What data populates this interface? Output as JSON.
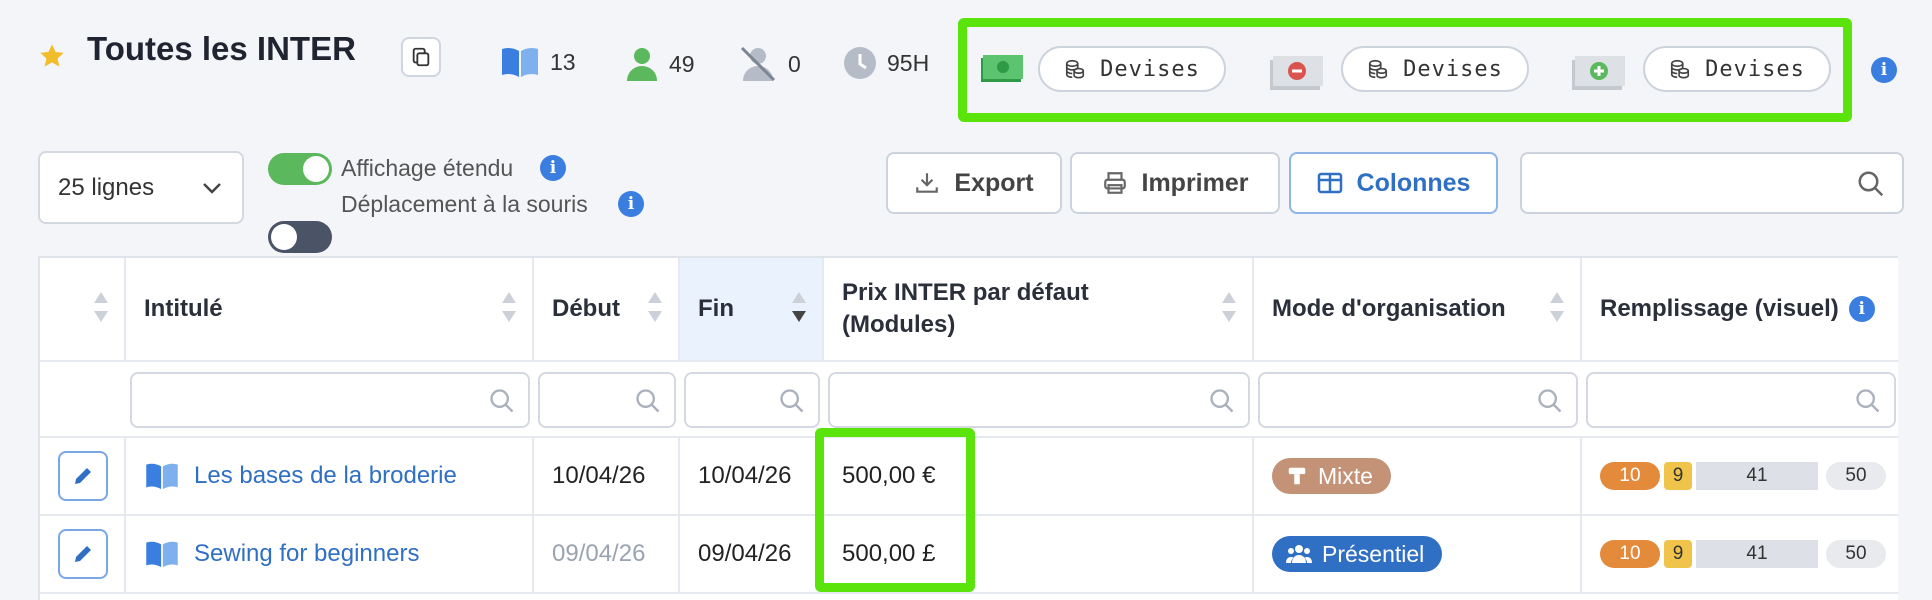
{
  "header": {
    "title": "Toutes les INTER",
    "stats": {
      "modules": "13",
      "users": "49",
      "no_users": "0",
      "hours": "95H"
    },
    "devises": [
      {
        "label": "Devises",
        "money_icon": "money-icon"
      },
      {
        "label": "Devises",
        "money_icon": "money-minus-icon"
      },
      {
        "label": "Devises",
        "money_icon": "money-plus-icon"
      }
    ]
  },
  "toolbar": {
    "lines_select": "25 lignes",
    "toggle_extended": {
      "label": "Affichage étendu",
      "on": true
    },
    "toggle_mouse": {
      "label": "Déplacement à la souris",
      "on": false
    },
    "export_label": "Export",
    "print_label": "Imprimer",
    "columns_label": "Colonnes",
    "search_value": ""
  },
  "table": {
    "columns": [
      "",
      "Intitulé",
      "Début",
      "Fin",
      "Prix INTER par défaut (Modules)",
      "Mode d'organisation",
      "Remplissage (visuel)"
    ],
    "header_line1": "Prix INTER par défaut",
    "header_line2": "(Modules)",
    "rows": [
      {
        "title": "Les bases de la broderie",
        "start": "10/04/26",
        "end": "10/04/26",
        "price": "500,00 €",
        "mode": "Mixte",
        "fill": [
          "10",
          "9",
          "41",
          "50"
        ]
      },
      {
        "title": "Sewing for beginners",
        "start": "09/04/26",
        "end": "09/04/26",
        "price": "500,00 £",
        "mode": "Présentiel",
        "fill": [
          "10",
          "9",
          "41",
          "50"
        ]
      }
    ]
  },
  "colors": {
    "highlight": "#5be30c",
    "accent": "#2f6fc4",
    "toggle_on": "#5cb85c",
    "mixte": "#c49276"
  }
}
